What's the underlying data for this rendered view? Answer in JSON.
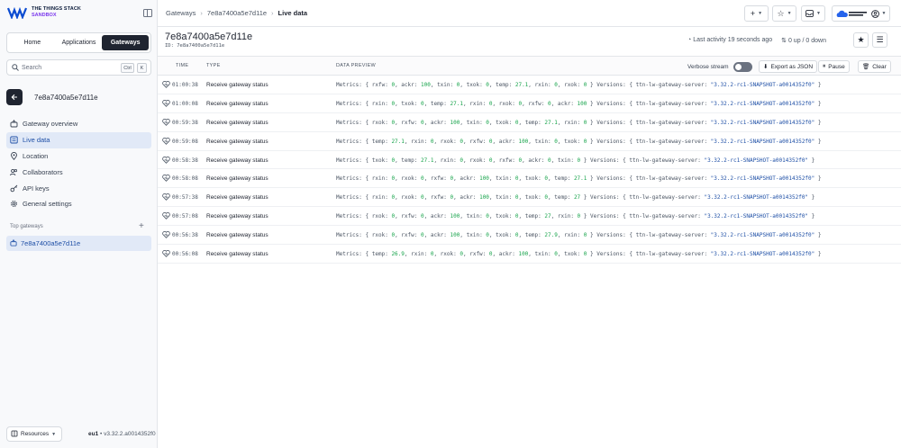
{
  "brand": {
    "line1": "THE THINGS STACK",
    "line2": "SANDBOX"
  },
  "sidebar": {
    "tabs": [
      {
        "label": "Home",
        "active": false
      },
      {
        "label": "Applications",
        "active": false
      },
      {
        "label": "Gateways",
        "active": true
      }
    ],
    "search": {
      "placeholder": "Search",
      "kbd1": "Ctrl",
      "kbd2": "K"
    },
    "gateway_title": "7e8a7400a5e7d11e",
    "nav": [
      {
        "label": "Gateway overview",
        "icon": "gateway-icon",
        "active": false
      },
      {
        "label": "Live data",
        "icon": "list-icon",
        "active": true
      },
      {
        "label": "Location",
        "icon": "location-icon",
        "active": false
      },
      {
        "label": "Collaborators",
        "icon": "people-icon",
        "active": false
      },
      {
        "label": "API keys",
        "icon": "key-icon",
        "active": false
      },
      {
        "label": "General settings",
        "icon": "gear-icon",
        "active": false
      }
    ],
    "top_gateways_label": "Top gateways",
    "top_gateway": "7e8a7400a5e7d11e",
    "resources_label": "Resources",
    "cluster": "eu1",
    "version": "v3.32.2.a0014352f0"
  },
  "header": {
    "breadcrumbs": [
      "Gateways",
      "7e8a7400a5e7d11e",
      "Live data"
    ],
    "plus": "+",
    "star": "☆"
  },
  "gateway": {
    "title": "7e8a7400a5e7d11e",
    "id_label": "ID: 7e8a7400a5e7d11e",
    "last_activity": "Last activity 19 seconds ago",
    "traffic": "0 up / 0 down"
  },
  "table": {
    "columns": {
      "time": "TIME",
      "type": "TYPE",
      "preview": "DATA PREVIEW"
    },
    "verbose_label": "Verbose stream",
    "export_label": "Export as JSON",
    "pause_label": "Pause",
    "clear_label": "Clear",
    "versions_key": "ttn-lw-gateway-server",
    "versions_value": "\"3.32.2-rc1-SNAPSHOT-a0014352f0\"",
    "rows": [
      {
        "time": "01:00:38",
        "type": "Receive gateway status",
        "metrics": [
          [
            "rxfw",
            "0"
          ],
          [
            "ackr",
            "100"
          ],
          [
            "txin",
            "0"
          ],
          [
            "txok",
            "0"
          ],
          [
            "temp",
            "27.1"
          ],
          [
            "rxin",
            "0"
          ],
          [
            "rxok",
            "0"
          ]
        ]
      },
      {
        "time": "01:00:08",
        "type": "Receive gateway status",
        "metrics": [
          [
            "rxin",
            "0"
          ],
          [
            "txok",
            "0"
          ],
          [
            "temp",
            "27.1"
          ],
          [
            "rxin",
            "0"
          ],
          [
            "rxok",
            "0"
          ],
          [
            "rxfw",
            "0"
          ],
          [
            "ackr",
            "100"
          ]
        ]
      },
      {
        "time": "00:59:38",
        "type": "Receive gateway status",
        "metrics": [
          [
            "rxok",
            "0"
          ],
          [
            "rxfw",
            "0"
          ],
          [
            "ackr",
            "100"
          ],
          [
            "txin",
            "0"
          ],
          [
            "txok",
            "0"
          ],
          [
            "temp",
            "27.1"
          ],
          [
            "rxin",
            "0"
          ]
        ]
      },
      {
        "time": "00:59:08",
        "type": "Receive gateway status",
        "metrics": [
          [
            "temp",
            "27.1"
          ],
          [
            "rxin",
            "0"
          ],
          [
            "rxok",
            "0"
          ],
          [
            "rxfw",
            "0"
          ],
          [
            "ackr",
            "100"
          ],
          [
            "txin",
            "0"
          ],
          [
            "txok",
            "0"
          ]
        ]
      },
      {
        "time": "00:58:38",
        "type": "Receive gateway status",
        "metrics": [
          [
            "txok",
            "0"
          ],
          [
            "temp",
            "27.1"
          ],
          [
            "rxin",
            "0"
          ],
          [
            "rxok",
            "0"
          ],
          [
            "rxfw",
            "0"
          ],
          [
            "ackr",
            "0"
          ],
          [
            "txin",
            "0"
          ]
        ]
      },
      {
        "time": "00:58:08",
        "type": "Receive gateway status",
        "metrics": [
          [
            "rxin",
            "0"
          ],
          [
            "rxok",
            "0"
          ],
          [
            "rxfw",
            "0"
          ],
          [
            "ackr",
            "100"
          ],
          [
            "txin",
            "0"
          ],
          [
            "txok",
            "0"
          ],
          [
            "temp",
            "27.1"
          ]
        ]
      },
      {
        "time": "00:57:38",
        "type": "Receive gateway status",
        "metrics": [
          [
            "rxin",
            "0"
          ],
          [
            "rxok",
            "0"
          ],
          [
            "rxfw",
            "0"
          ],
          [
            "ackr",
            "100"
          ],
          [
            "txin",
            "0"
          ],
          [
            "txok",
            "0"
          ],
          [
            "temp",
            "27"
          ]
        ]
      },
      {
        "time": "00:57:08",
        "type": "Receive gateway status",
        "metrics": [
          [
            "rxok",
            "0"
          ],
          [
            "rxfw",
            "0"
          ],
          [
            "ackr",
            "100"
          ],
          [
            "txin",
            "0"
          ],
          [
            "txok",
            "0"
          ],
          [
            "temp",
            "27"
          ],
          [
            "rxin",
            "0"
          ]
        ]
      },
      {
        "time": "00:56:38",
        "type": "Receive gateway status",
        "metrics": [
          [
            "rxok",
            "0"
          ],
          [
            "rxfw",
            "0"
          ],
          [
            "ackr",
            "100"
          ],
          [
            "txin",
            "0"
          ],
          [
            "txok",
            "0"
          ],
          [
            "temp",
            "27.9"
          ],
          [
            "rxin",
            "0"
          ]
        ]
      },
      {
        "time": "00:56:08",
        "type": "Receive gateway status",
        "metrics": [
          [
            "temp",
            "26.9"
          ],
          [
            "rxin",
            "0"
          ],
          [
            "rxok",
            "0"
          ],
          [
            "rxfw",
            "0"
          ],
          [
            "ackr",
            "100"
          ],
          [
            "txin",
            "0"
          ],
          [
            "txok",
            "0"
          ]
        ]
      }
    ]
  },
  "colors": {
    "accent": "#1e4fa6",
    "number": "#16a34a",
    "dark": "#1f2430",
    "brand_purple": "#7c3aed"
  }
}
